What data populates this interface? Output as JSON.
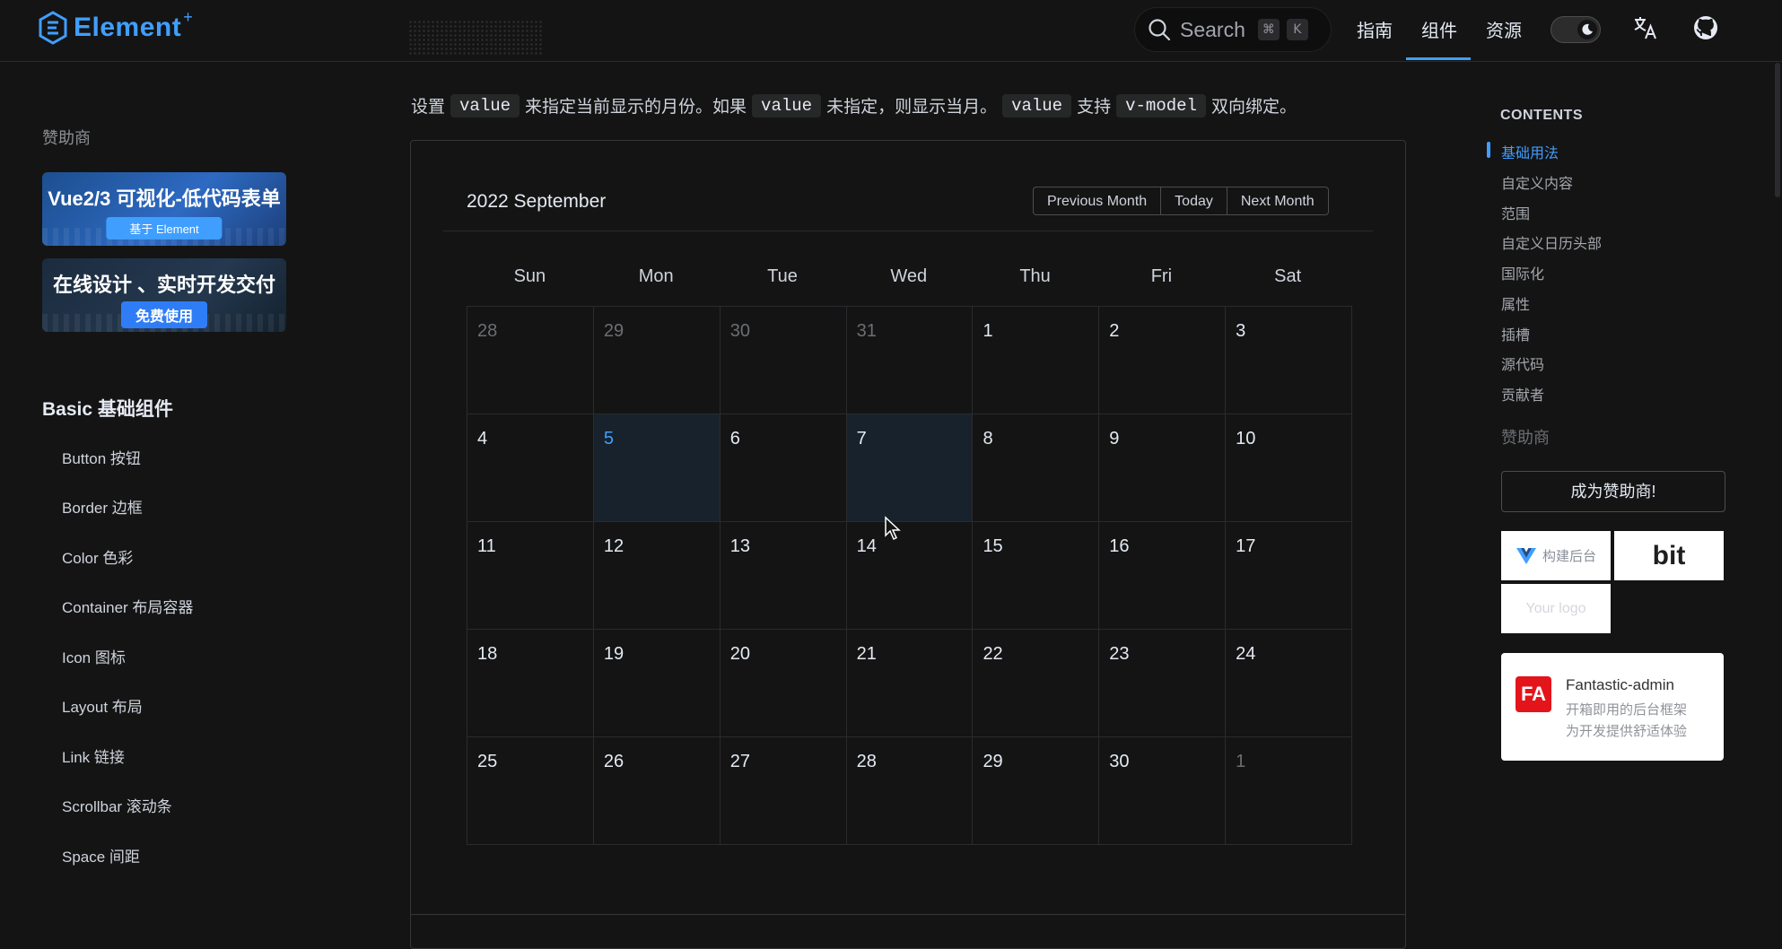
{
  "header": {
    "logo_text": "Element",
    "logo_plus": "+",
    "search_placeholder": "Search",
    "search_key_1": "⌘",
    "search_key_2": "K",
    "nav": [
      "指南",
      "组件",
      "资源"
    ],
    "active_nav": "组件"
  },
  "sidebar": {
    "sponsor_title": "赞助商",
    "banner1_title": "Vue2/3 可视化-低代码表单",
    "banner1_button": "基于 Element",
    "banner2_title": "在线设计 、实时开发交付",
    "banner2_button": "免费使用",
    "section_title": "Basic 基础组件",
    "items": [
      "Button 按钮",
      "Border 边框",
      "Color 色彩",
      "Container 布局容器",
      "Icon 图标",
      "Layout 布局",
      "Link 链接",
      "Scrollbar 滚动条",
      "Space 间距"
    ]
  },
  "main": {
    "desc": {
      "t1": "设置",
      "c1": "value",
      "t2": "来指定当前显示的月份。如果",
      "c2": "value",
      "t3": "未指定，则显示当月。",
      "c3": "value",
      "t4": "支持",
      "c4": "v-model",
      "t5": "双向绑定。"
    },
    "calendar": {
      "title": "2022 September",
      "buttons": [
        "Previous Month",
        "Today",
        "Next Month"
      ],
      "weekdays": [
        "Sun",
        "Mon",
        "Tue",
        "Wed",
        "Thu",
        "Fri",
        "Sat"
      ],
      "weeks": [
        [
          {
            "d": "28",
            "o": true
          },
          {
            "d": "29",
            "o": true
          },
          {
            "d": "30",
            "o": true
          },
          {
            "d": "31",
            "o": true
          },
          {
            "d": "1"
          },
          {
            "d": "2"
          },
          {
            "d": "3"
          }
        ],
        [
          {
            "d": "4"
          },
          {
            "d": "5",
            "sel": true
          },
          {
            "d": "6"
          },
          {
            "d": "7",
            "hover": true
          },
          {
            "d": "8"
          },
          {
            "d": "9"
          },
          {
            "d": "10"
          }
        ],
        [
          {
            "d": "11"
          },
          {
            "d": "12"
          },
          {
            "d": "13"
          },
          {
            "d": "14"
          },
          {
            "d": "15"
          },
          {
            "d": "16"
          },
          {
            "d": "17"
          }
        ],
        [
          {
            "d": "18"
          },
          {
            "d": "19"
          },
          {
            "d": "20"
          },
          {
            "d": "21"
          },
          {
            "d": "22"
          },
          {
            "d": "23"
          },
          {
            "d": "24"
          }
        ],
        [
          {
            "d": "25"
          },
          {
            "d": "26"
          },
          {
            "d": "27"
          },
          {
            "d": "28"
          },
          {
            "d": "29"
          },
          {
            "d": "30"
          },
          {
            "d": "1",
            "o": true
          }
        ]
      ]
    }
  },
  "toc": {
    "title": "CONTENTS",
    "items": [
      "基础用法",
      "自定义内容",
      "范围",
      "自定义日历头部",
      "国际化",
      "属性",
      "插槽",
      "源代码",
      "贡献者"
    ],
    "active_index": 0,
    "sponsor_title": "赞助商",
    "become_sponsor": "成为赞助商!",
    "sponsor1": "构建后台",
    "sponsor2": "bit",
    "sponsor3": "Your logo",
    "fa_logo": "FA",
    "fa_name": "Fantastic-admin",
    "fa_desc1": "开箱即用的后台框架",
    "fa_desc2": "为开发提供舒适体验"
  },
  "colors": {
    "background": "#141414",
    "accent": "#409eff",
    "border": "#2a2b2e"
  }
}
